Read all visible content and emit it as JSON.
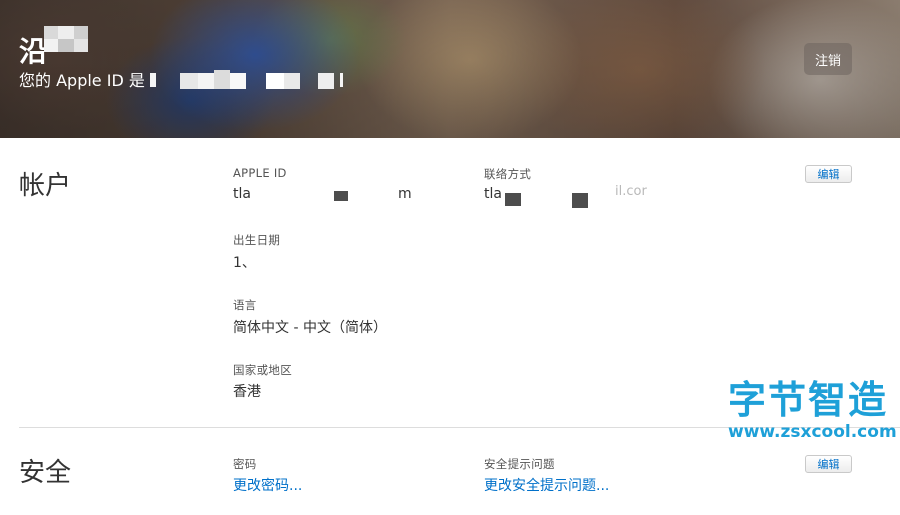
{
  "hero": {
    "name": "沿",
    "appleid_prefix": "您的 Apple ID 是",
    "signout_label": "注销"
  },
  "account": {
    "title": "帐户",
    "edit_label": "编辑",
    "apple_id": {
      "label": "APPLE ID",
      "value": "tla",
      "value_tail": "m"
    },
    "contact": {
      "label": "联络方式",
      "value": "tla",
      "value_tail": "il.cor"
    },
    "birthday": {
      "label": "出生日期",
      "value": "1、"
    },
    "language": {
      "label": "语言",
      "value": "简体中文 - 中文（简体）"
    },
    "region": {
      "label": "国家或地区",
      "value": "香港"
    }
  },
  "security": {
    "title": "安全",
    "edit_label": "编辑",
    "password": {
      "label": "密码",
      "link": "更改密码..."
    },
    "questions": {
      "label": "安全提示问题",
      "link": "更改安全提示问题..."
    }
  },
  "watermark": {
    "text": "字节智造",
    "url": "www.zsxcool.com"
  },
  "colors": {
    "link": "#0070c9",
    "watermark": "#1ea0d8",
    "divider": "#dddddd"
  },
  "icons": []
}
